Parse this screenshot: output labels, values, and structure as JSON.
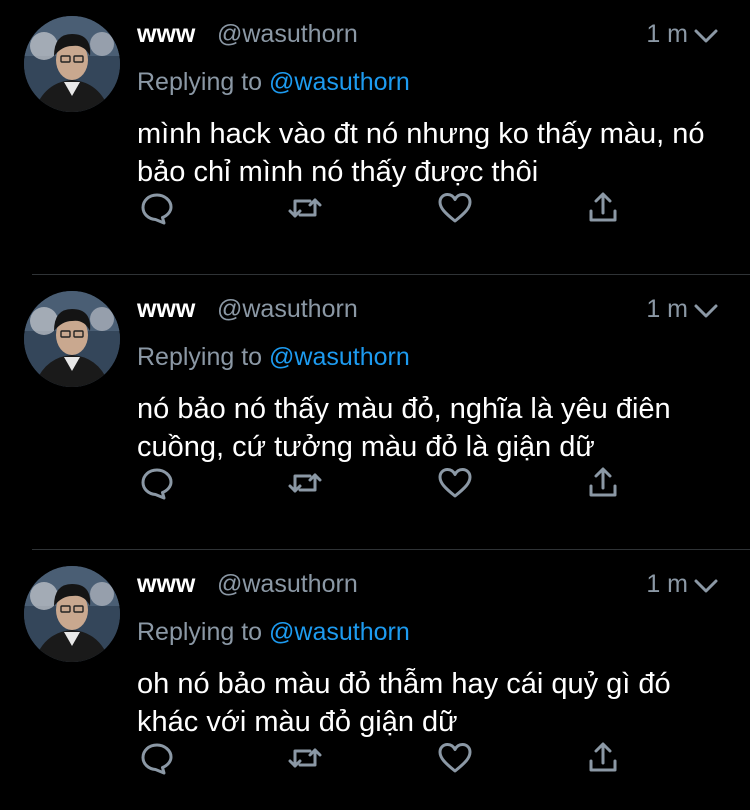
{
  "tweets": [
    {
      "name": "www",
      "handle": "@wasuthorn",
      "time": "1 m",
      "replying_label": "Replying to",
      "reply_to": "@wasuthorn",
      "text": "mình hack vào đt nó nhưng ko thấy màu, nó bảo chỉ mình nó thấy được thôi"
    },
    {
      "name": "www",
      "handle": "@wasuthorn",
      "time": "1 m",
      "replying_label": "Replying to",
      "reply_to": "@wasuthorn",
      "text": "nó bảo nó thấy màu đỏ, nghĩa là yêu điên cuồng, cứ tưởng màu đỏ là giận dữ"
    },
    {
      "name": "www",
      "handle": "@wasuthorn",
      "time": "1 m",
      "replying_label": "Replying to",
      "reply_to": "@wasuthorn",
      "text": "oh nó bảo màu đỏ thẫm hay cái quỷ gì đó khác với màu đỏ giận dữ"
    }
  ],
  "icons": {
    "reply": "reply-icon",
    "retweet": "retweet-icon",
    "like": "heart-icon",
    "share": "share-icon",
    "menu": "chevron-down-icon"
  },
  "colors": {
    "background": "#000000",
    "secondary_text": "#8b98a5",
    "mention": "#1d9bf0",
    "divider": "#2f3336"
  }
}
